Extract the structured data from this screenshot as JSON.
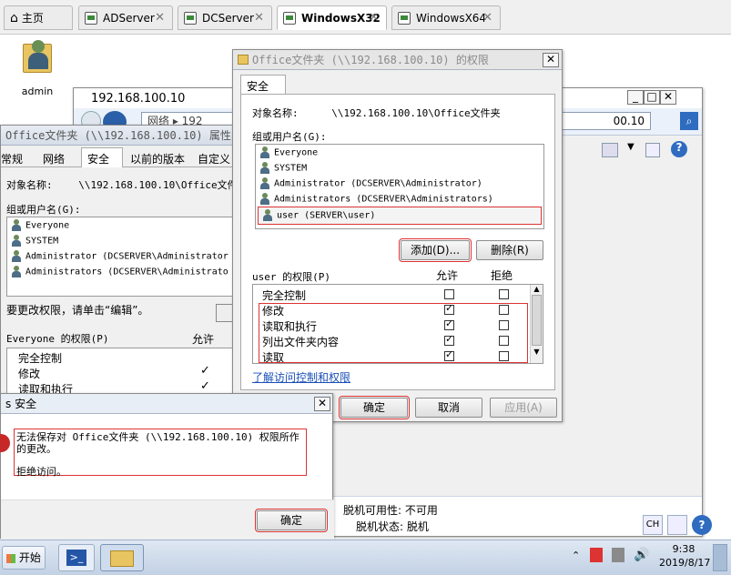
{
  "browser_tabs": [
    {
      "label": "主页",
      "active": false
    },
    {
      "label": "ADServer",
      "active": false
    },
    {
      "label": "DCServer",
      "active": false
    },
    {
      "label": "WindowsX32",
      "active": true
    },
    {
      "label": "WindowsX64",
      "active": false
    }
  ],
  "desktop": {
    "icon_label": "admin"
  },
  "explorer": {
    "title": "192.168.100.10",
    "nav_text": "网络 ▸ 192",
    "address_value": "00.10",
    "status": {
      "offline_availability_label": "脱机可用性:",
      "offline_availability_value": "不可用",
      "offline_status_label": "脱机状态:",
      "offline_status_value": "脱机"
    }
  },
  "props": {
    "title": "Office文件夹 (\\\\192.168.100.10) 属性",
    "tabs": [
      "常规",
      "网络",
      "安全",
      "以前的版本",
      "自定义"
    ],
    "object_label": "对象名称:",
    "object_value": "\\\\192.168.100.10\\Office文件夹",
    "group_label": "组或用户名(G):",
    "users": [
      "Everyone",
      "SYSTEM",
      "Administrator (DCSERVER\\Administrator",
      "Administrators (DCSERVER\\Administrato"
    ],
    "edit_hint": "要更改权限，请单击“编辑”。",
    "perm_label": "Everyone 的权限(P)",
    "allow_label": "允许",
    "perms": [
      "完全控制",
      "修改",
      "读取和执行"
    ]
  },
  "perm_dialog": {
    "title": "Office文件夹 (\\\\192.168.100.10) 的权限",
    "tab": "安全",
    "object_label": "对象名称:",
    "object_value": "\\\\192.168.100.10\\Office文件夹",
    "group_label": "组或用户名(G):",
    "users": [
      "Everyone",
      "SYSTEM",
      "Administrator (DCSERVER\\Administrator)",
      "Administrators (DCSERVER\\Administrators)",
      "user (SERVER\\user)"
    ],
    "add_label": "添加(D)...",
    "remove_label": "删除(R)",
    "perm_label": "user 的权限(P)",
    "allow_label": "允许",
    "deny_label": "拒绝",
    "perms": [
      {
        "name": "完全控制",
        "allow": false,
        "deny": false
      },
      {
        "name": "修改",
        "allow": true,
        "deny": false
      },
      {
        "name": "读取和执行",
        "allow": true,
        "deny": false
      },
      {
        "name": "列出文件夹内容",
        "allow": true,
        "deny": false
      },
      {
        "name": "读取",
        "allow": true,
        "deny": false
      }
    ],
    "learn_link": "了解访问控制和权限",
    "ok": "确定",
    "cancel": "取消",
    "apply": "应用(A)"
  },
  "error": {
    "title": "s 安全",
    "message": "无法保存对 Office文件夹 (\\\\192.168.100.10) 权限所作的更改。",
    "detail": "拒绝访问。",
    "ok": "确定"
  },
  "taskbar": {
    "start": "开始",
    "lang": "CH",
    "time": "9:38",
    "date": "2019/8/17"
  }
}
